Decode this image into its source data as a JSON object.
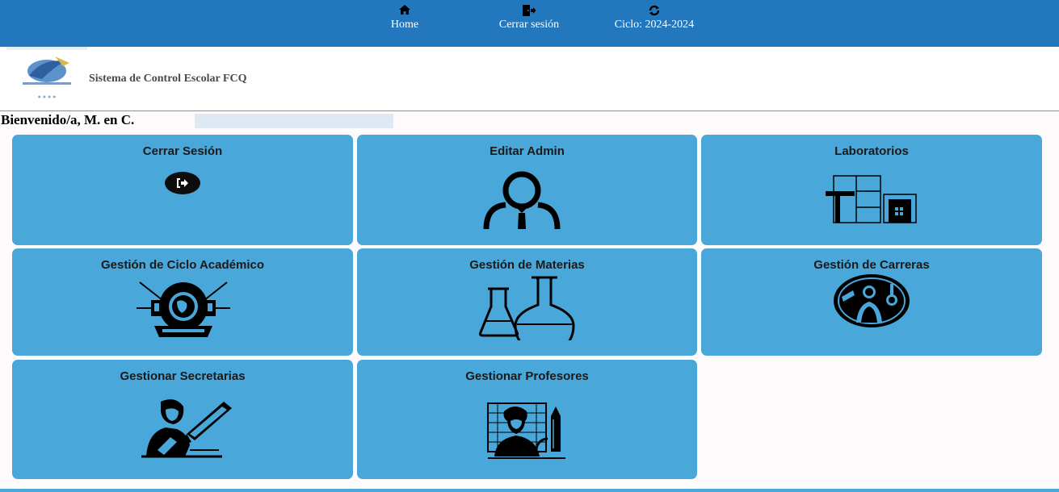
{
  "nav": {
    "home": "Home",
    "logout": "Cerrar sesión",
    "ciclo": "Ciclo: 2024-2024"
  },
  "header": {
    "system_title": "Sistema de Control Escolar FCQ"
  },
  "welcome": {
    "text": "Bienvenido/a, M. en C."
  },
  "cards": [
    {
      "title": "Cerrar Sesión",
      "icon": "logout-icon"
    },
    {
      "title": "Editar Admin",
      "icon": "user-icon"
    },
    {
      "title": "Laboratorios",
      "icon": "laboratory-icon"
    },
    {
      "title": "Gestión de Ciclo Académico",
      "icon": "academic-emblem-icon"
    },
    {
      "title": "Gestión de Materias",
      "icon": "flask-icon"
    },
    {
      "title": "Gestión de Carreras",
      "icon": "scientist-icon"
    },
    {
      "title": "Gestionar Secretarias",
      "icon": "secretary-icon"
    },
    {
      "title": "Gestionar Profesores",
      "icon": "professor-icon"
    }
  ],
  "colors": {
    "nav_bg": "#2377bd",
    "card_bg": "#4aa7d9"
  }
}
